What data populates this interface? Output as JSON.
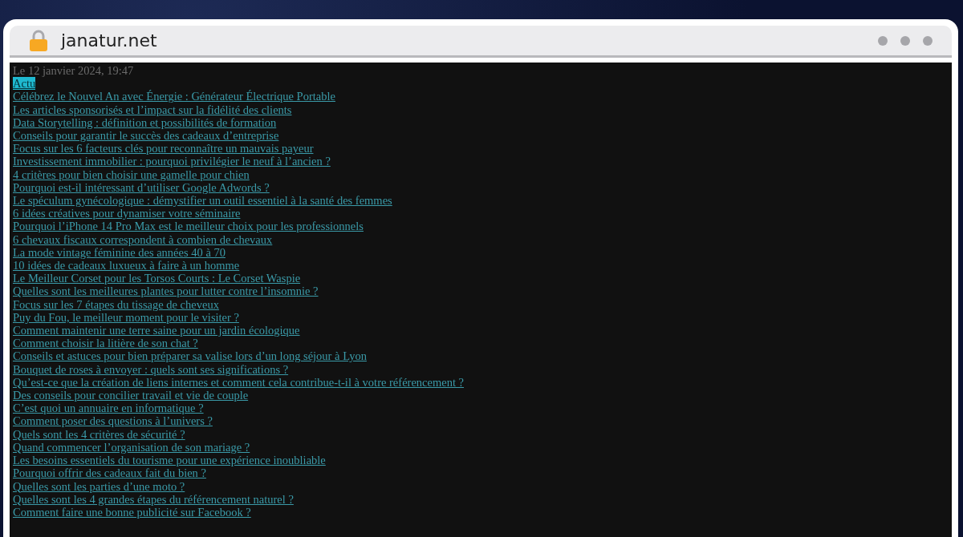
{
  "browser": {
    "url": "janatur.net"
  },
  "page": {
    "date": "Le 12 janvier 2024, 19:47",
    "category": "Actu",
    "links": [
      "Célébrez le Nouvel An avec Énergie : Générateur Électrique Portable",
      "Les articles sponsorisés et l’impact sur la fidélité des clients",
      "Data Storytelling : définition et possibilités de formation",
      "Conseils pour garantir le succès des cadeaux d’entreprise",
      "Focus sur les 6 facteurs clés pour reconnaître un mauvais payeur",
      "Investissement immobilier : pourquoi privilégier le neuf à l’ancien ?",
      "4 critères pour bien choisir une gamelle pour chien",
      "Pourquoi est-il intéressant d’utiliser Google Adwords ?",
      "Le spéculum gynécologique : démystifier un outil essentiel à la santé des femmes",
      "6 idées créatives pour dynamiser votre séminaire",
      "Pourquoi l’iPhone 14 Pro Max est le meilleur choix pour les professionnels",
      "6 chevaux fiscaux correspondent à combien de chevaux",
      "La mode vintage féminine des années 40 à 70",
      "10 idées de cadeaux luxueux à faire à un homme",
      "Le Meilleur Corset pour les Torsos Courts : Le Corset Waspie",
      "Quelles sont les meilleures plantes pour lutter contre l’insomnie ?",
      "Focus sur les 7 étapes du tissage de cheveux",
      "Puy du Fou, le meilleur moment pour le visiter ?",
      "Comment maintenir une terre saine pour un jardin écologique",
      "Comment choisir la litière de son chat ?",
      "Conseils et astuces pour bien préparer sa valise lors d’un long séjour à Lyon",
      "Bouquet de roses à envoyer : quels sont ses significations ?",
      "Qu’est-ce que la création de liens internes et comment cela contribue-t-il à votre référencement ?",
      "Des conseils pour concilier travail et vie de couple",
      "C’est quoi un annuaire en informatique ?",
      "Comment poser des questions à l’univers ?",
      "Quels sont les 4 critères de sécurité ?",
      "Quand commencer l’organisation de son mariage ?",
      "Les besoins essentiels du tourisme pour une expérience inoubliable",
      "Pourquoi offrir des cadeaux fait du bien ?",
      "Quelles sont les parties d’une moto ?",
      "Quelles sont les 4 grandes étapes du référencement naturel ?",
      "Comment faire une bonne publicité sur Facebook ?"
    ]
  }
}
